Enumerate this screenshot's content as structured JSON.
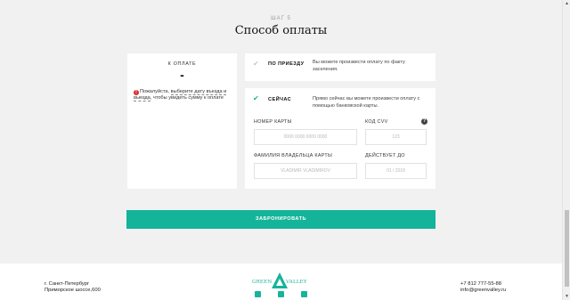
{
  "step": {
    "label": "ШАГ 5",
    "title": "Способ оплаты"
  },
  "summary": {
    "caption": "К ОПЛАТЕ",
    "amount": "-",
    "warning_prefix": "Пожалуйста, ",
    "warning_link": "выберите дату въезда и выезда",
    "warning_suffix": ", чтобы увидеть сумму к оплате"
  },
  "options": [
    {
      "title": "ПО ПРИЕЗДУ",
      "description": "Вы можете произвести оплату по факту заселения.",
      "selected": false
    },
    {
      "title": "СЕЙЧАС",
      "description": "Прямо сейчас вы можете произвести оплату с помощью банковской карты.",
      "selected": true
    }
  ],
  "card_form": {
    "card_number_label": "НОМЕР КАРТЫ",
    "card_number_placeholder": "0000 0000 0000 0000",
    "cvv_label": "КОД CVV",
    "cvv_placeholder": "123",
    "holder_label": "ФАМИЛИЯ ВЛАДЕЛЬЦА КАРТЫ",
    "holder_placeholder": "VLADIMIR VLADIMIROV",
    "expiry_label": "ДЕЙСТВУЕТ ДО",
    "expiry_placeholder": "01 / 2018",
    "help_glyph": "?"
  },
  "book_button": "ЗАБРОНИРОВАТЬ",
  "footer": {
    "address_line1": "г. Санкт-Петербург",
    "address_line2": "Приморское шоссе,600",
    "logo_left": "GREEN",
    "logo_right": "VALLEY",
    "phone": "+7 812 777-55-88",
    "email": "info@greenvalley.ru"
  },
  "colors": {
    "accent": "#14b49a",
    "warning": "#d92b2b",
    "background": "#f1f1f1"
  },
  "icons": {
    "check": "check-icon",
    "help": "question-circle-icon",
    "warning": "exclamation-circle-icon"
  }
}
